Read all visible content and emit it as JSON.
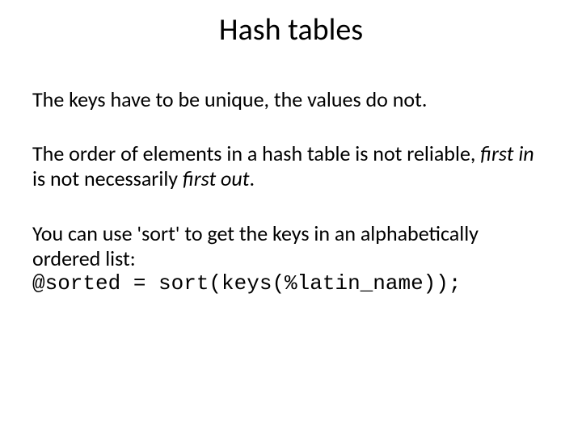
{
  "title": "Hash tables",
  "p1": "The keys have to be unique, the values do not.",
  "p2a": "The order of elements in a hash table is not reliable, ",
  "p2b": "first in",
  "p2c": " is not necessarily ",
  "p2d": "first out",
  "p2e": ".",
  "p3a": "You can use 'sort' to get the keys in an alphabetically  ordered list:",
  "p3b": "@sorted = sort(keys(%latin_name));"
}
